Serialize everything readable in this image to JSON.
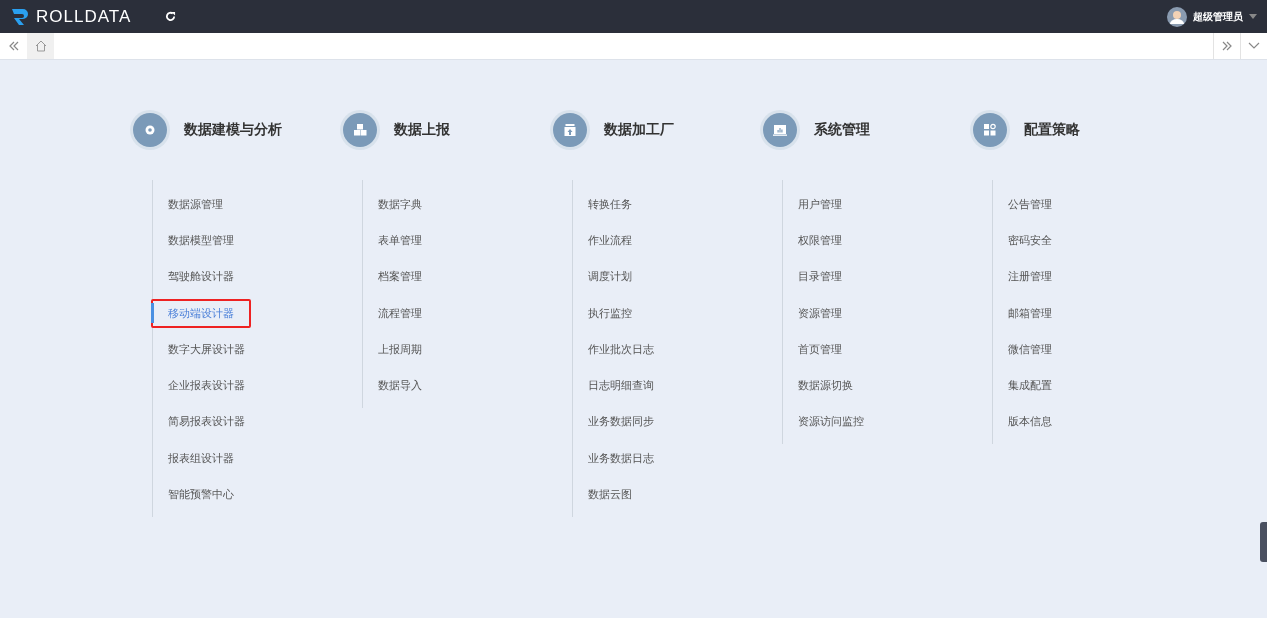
{
  "header": {
    "logo": "ROLLDATA",
    "user": "超级管理员"
  },
  "groups": [
    {
      "title": "数据建模与分析",
      "items": [
        {
          "label": "数据源管理",
          "selected": false
        },
        {
          "label": "数据模型管理",
          "selected": false
        },
        {
          "label": "驾驶舱设计器",
          "selected": false
        },
        {
          "label": "移动端设计器",
          "selected": true
        },
        {
          "label": "数字大屏设计器",
          "selected": false
        },
        {
          "label": "企业报表设计器",
          "selected": false
        },
        {
          "label": "简易报表设计器",
          "selected": false
        },
        {
          "label": "报表组设计器",
          "selected": false
        },
        {
          "label": "智能预警中心",
          "selected": false
        }
      ]
    },
    {
      "title": "数据上报",
      "items": [
        {
          "label": "数据字典",
          "selected": false
        },
        {
          "label": "表单管理",
          "selected": false
        },
        {
          "label": "档案管理",
          "selected": false
        },
        {
          "label": "流程管理",
          "selected": false
        },
        {
          "label": "上报周期",
          "selected": false
        },
        {
          "label": "数据导入",
          "selected": false
        }
      ]
    },
    {
      "title": "数据加工厂",
      "items": [
        {
          "label": "转换任务",
          "selected": false
        },
        {
          "label": "作业流程",
          "selected": false
        },
        {
          "label": "调度计划",
          "selected": false
        },
        {
          "label": "执行监控",
          "selected": false
        },
        {
          "label": "作业批次日志",
          "selected": false
        },
        {
          "label": "日志明细查询",
          "selected": false
        },
        {
          "label": "业务数据同步",
          "selected": false
        },
        {
          "label": "业务数据日志",
          "selected": false
        },
        {
          "label": "数据云图",
          "selected": false
        }
      ]
    },
    {
      "title": "系统管理",
      "items": [
        {
          "label": "用户管理",
          "selected": false
        },
        {
          "label": "权限管理",
          "selected": false
        },
        {
          "label": "目录管理",
          "selected": false
        },
        {
          "label": "资源管理",
          "selected": false
        },
        {
          "label": "首页管理",
          "selected": false
        },
        {
          "label": "数据源切换",
          "selected": false
        },
        {
          "label": "资源访问监控",
          "selected": false
        }
      ]
    },
    {
      "title": "配置策略",
      "items": [
        {
          "label": "公告管理",
          "selected": false
        },
        {
          "label": "密码安全",
          "selected": false
        },
        {
          "label": "注册管理",
          "selected": false
        },
        {
          "label": "邮箱管理",
          "selected": false
        },
        {
          "label": "微信管理",
          "selected": false
        },
        {
          "label": "集成配置",
          "selected": false
        },
        {
          "label": "版本信息",
          "selected": false
        }
      ]
    }
  ]
}
